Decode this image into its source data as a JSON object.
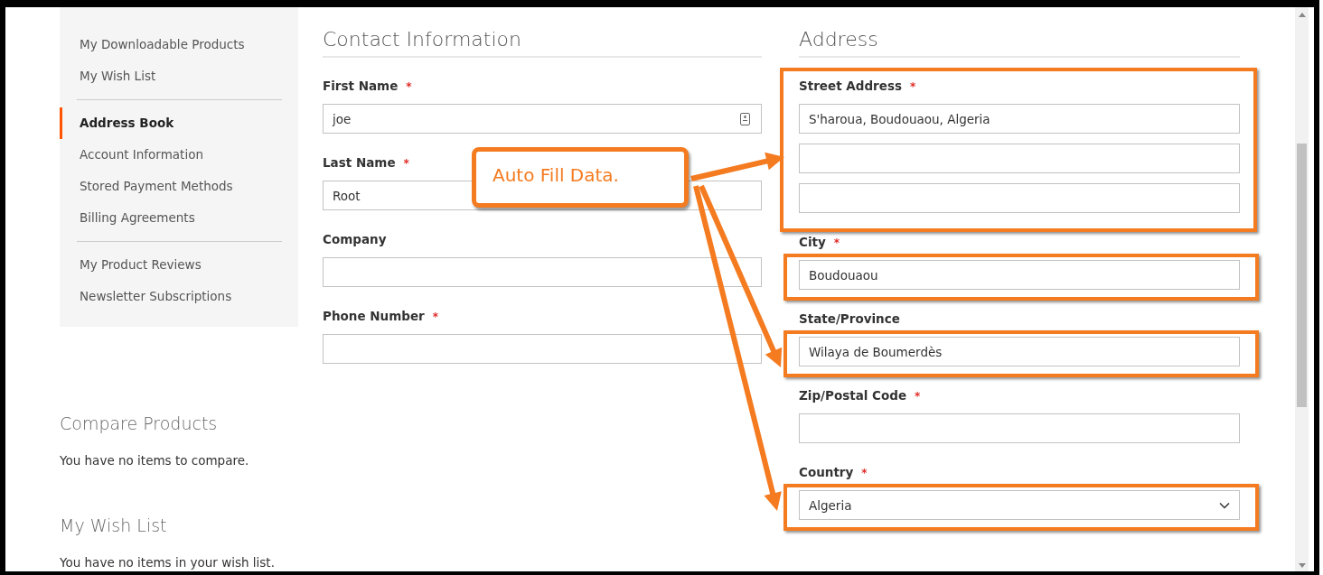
{
  "sidebar": {
    "groups": [
      {
        "items": [
          {
            "label": "My Downloadable Products",
            "selected": false
          },
          {
            "label": "My Wish List",
            "selected": false
          }
        ]
      },
      {
        "items": [
          {
            "label": "Address Book",
            "selected": true
          },
          {
            "label": "Account Information",
            "selected": false
          },
          {
            "label": "Stored Payment Methods",
            "selected": false
          },
          {
            "label": "Billing Agreements",
            "selected": false
          }
        ]
      },
      {
        "items": [
          {
            "label": "My Product Reviews",
            "selected": false
          },
          {
            "label": "Newsletter Subscriptions",
            "selected": false
          }
        ]
      }
    ]
  },
  "compare": {
    "title": "Compare Products",
    "text": "You have no items to compare."
  },
  "wishlist": {
    "title": "My Wish List",
    "text": "You have no items in your wish list."
  },
  "contact": {
    "title": "Contact Information",
    "fields": [
      {
        "kind": "contact",
        "label": "First Name",
        "required_mark": "*",
        "value": "joe"
      },
      {
        "kind": "text",
        "label": "Last Name",
        "required_mark": "*",
        "value": "Root"
      },
      {
        "kind": "text",
        "label": "Company"
      },
      {
        "kind": "text",
        "label": "Phone Number",
        "required_mark": "*"
      }
    ]
  },
  "address": {
    "title": "Address",
    "fields": [
      {
        "kind": "multiline",
        "label": "Street Address",
        "required_mark": "*",
        "value": "S'haroua, Boudouaou, Algeria",
        "highlighted": true
      },
      {
        "kind": "text",
        "label": "City",
        "required_mark": "*",
        "value": "Boudouaou",
        "highlighted": true
      },
      {
        "kind": "text",
        "label": "State/Province",
        "value": "Wilaya de Boumerdès",
        "highlighted": true
      },
      {
        "kind": "text",
        "label": "Zip/Postal Code",
        "required_mark": "*",
        "highlighted": false
      },
      {
        "kind": "select",
        "label": "Country",
        "required_mark": "*",
        "value": "Algeria",
        "highlighted": true
      }
    ]
  },
  "annotation": {
    "text": "Auto Fill Data."
  }
}
